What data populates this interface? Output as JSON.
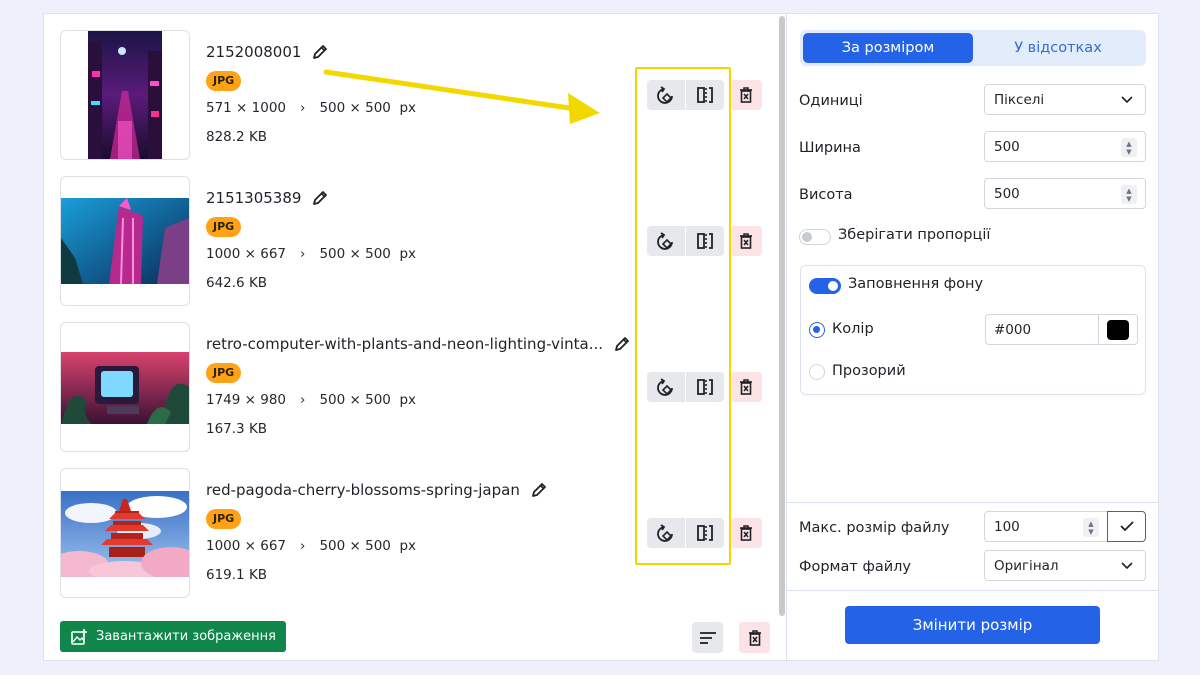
{
  "images": [
    {
      "name": "2152008001",
      "format": "JPG",
      "original_dims": "571 × 1000",
      "target_dims": "500 × 500",
      "unit": "px",
      "size": "828.2 KB"
    },
    {
      "name": "2151305389",
      "format": "JPG",
      "original_dims": "1000 × 667",
      "target_dims": "500 × 500",
      "unit": "px",
      "size": "642.6 KB"
    },
    {
      "name": "retro-computer-with-plants-and-neon-lighting-vinta...",
      "format": "JPG",
      "original_dims": "1749 × 980",
      "target_dims": "500 × 500",
      "unit": "px",
      "size": "167.3 KB"
    },
    {
      "name": "red-pagoda-cherry-blossoms-spring-japan",
      "format": "JPG",
      "original_dims": "1000 × 667",
      "target_dims": "500 × 500",
      "unit": "px",
      "size": "619.1 KB"
    }
  ],
  "dims_separator": "›",
  "upload_button": "Завантажити зображення",
  "settings": {
    "mode_tabs": [
      "За розміром",
      "У відсотках"
    ],
    "units_label": "Одиниці",
    "units_value": "Пікселі",
    "width_label": "Ширина",
    "width_value": "500",
    "height_label": "Висота",
    "height_value": "500",
    "keep_ratio_label": "Зберігати пропорції",
    "keep_ratio_on": false,
    "fill_label": "Заповнення фону",
    "fill_on": true,
    "color_label": "Колір",
    "color_value": "#000",
    "transparent_label": "Прозорий",
    "max_size_label": "Макс. розмір файлу",
    "max_size_value": "100",
    "format_label": "Формат файлу",
    "format_value": "Оригінал",
    "resize_button": "Змінити розмір"
  },
  "colors": {
    "accent": "#2463e8",
    "badge": "#ffa215",
    "upload": "#10864a",
    "highlight": "#f3d800",
    "swatch": "#000000"
  }
}
